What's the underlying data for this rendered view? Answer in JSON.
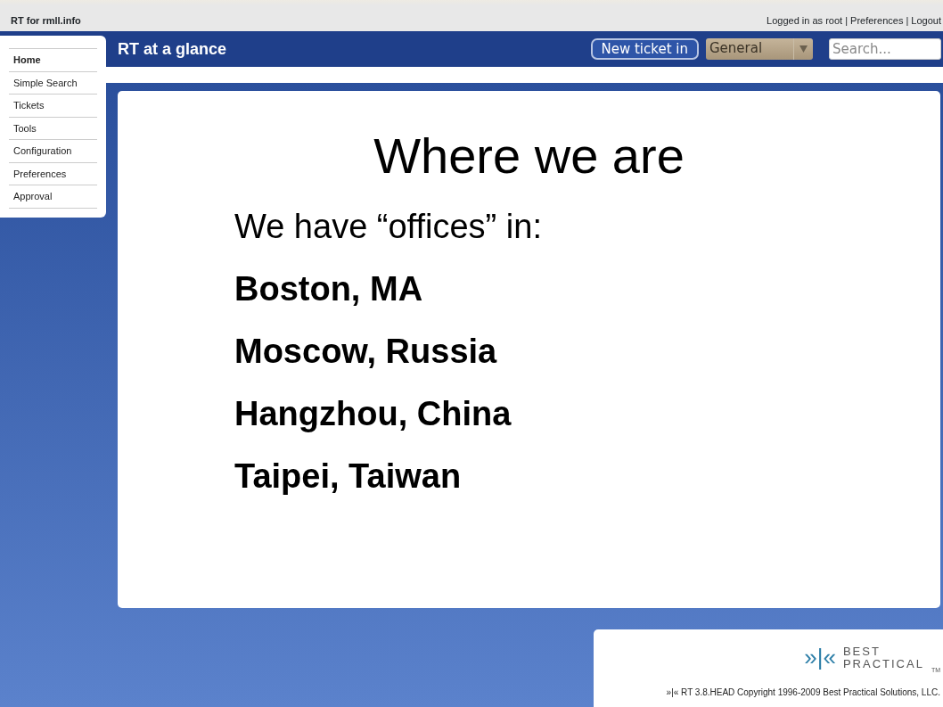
{
  "topbar": {
    "site_title": "RT for rmll.info",
    "user_links": "Logged in as root | Preferences | Logout"
  },
  "sidebar": {
    "items": [
      {
        "label": "Home",
        "selected": true
      },
      {
        "label": "Simple Search",
        "selected": false
      },
      {
        "label": "Tickets",
        "selected": false
      },
      {
        "label": "Tools",
        "selected": false
      },
      {
        "label": "Configuration",
        "selected": false
      },
      {
        "label": "Preferences",
        "selected": false
      },
      {
        "label": "Approval",
        "selected": false
      }
    ]
  },
  "header": {
    "title": "RT at a glance",
    "new_ticket_button": "New ticket in",
    "queue_select": "General",
    "search": {
      "placeholder": "Search..."
    }
  },
  "slide": {
    "title": "Where we are",
    "lines": [
      {
        "text": "We have “offices” in:",
        "bold": false
      },
      {
        "text": "Boston, MA",
        "bold": true
      },
      {
        "text": "Moscow, Russia",
        "bold": true
      },
      {
        "text": "Hangzhou, China",
        "bold": true
      },
      {
        "text": "Taipei, Taiwan",
        "bold": true
      }
    ]
  },
  "footer": {
    "logo_mark": "»|«",
    "logo_text_1": "BEST",
    "logo_text_2": "PRACTICAL",
    "logo_tm": "TM",
    "copyright": "»|« RT 3.8.HEAD Copyright 1996-2009 Best Practical Solutions, LLC."
  }
}
